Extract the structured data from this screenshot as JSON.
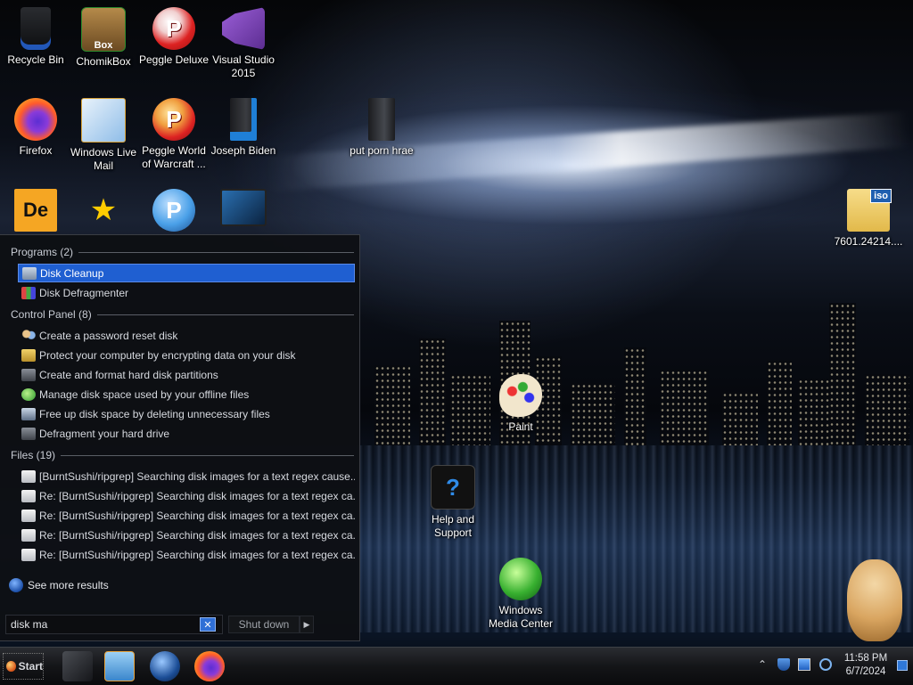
{
  "desktop_icons": [
    {
      "label": "Recycle Bin",
      "icon": "recycle-bin-icon"
    },
    {
      "label": "ChomikBox",
      "icon": "chomikbox-icon"
    },
    {
      "label": "Peggle Deluxe",
      "icon": "peggle-icon"
    },
    {
      "label": "Visual Studio 2015",
      "icon": "visual-studio-icon"
    },
    {
      "label": "Firefox",
      "icon": "firefox-icon"
    },
    {
      "label": "Windows Live Mail",
      "icon": "mail-icon"
    },
    {
      "label": "Peggle World of Warcraft ...",
      "icon": "peggle-icon"
    },
    {
      "label": "Joseph Biden",
      "icon": "user-folder-icon"
    },
    {
      "label": "put porn hrae",
      "icon": "folder-icon"
    },
    {
      "label": "7601.24214....",
      "icon": "iso-icon"
    },
    {
      "label": "Paint",
      "icon": "paint-icon"
    },
    {
      "label": "Help and Support",
      "icon": "help-icon"
    },
    {
      "label": "Windows Media Center",
      "icon": "media-center-icon"
    }
  ],
  "start_menu": {
    "sections": {
      "programs": "Programs (2)",
      "control_panel": "Control Panel (8)",
      "files": "Files (19)"
    },
    "programs": [
      "Disk Cleanup",
      "Disk Defragmenter"
    ],
    "control_panel": [
      "Create a password reset disk",
      "Protect your computer by encrypting data on your disk",
      "Create and format hard disk partitions",
      "Manage disk space used by your offline files",
      "Free up disk space by deleting unnecessary files",
      "Defragment your hard drive"
    ],
    "files": [
      "[BurntSushi/ripgrep] Searching disk images for a text regex cause...",
      "Re: [BurntSushi/ripgrep] Searching disk images for a text regex ca...",
      "Re: [BurntSushi/ripgrep] Searching disk images for a text regex ca...",
      "Re: [BurntSushi/ripgrep] Searching disk images for a text regex ca...",
      "Re: [BurntSushi/ripgrep] Searching disk images for a text regex ca..."
    ],
    "see_more": "See more results",
    "search_value": "disk ma",
    "shutdown_label": "Shut down",
    "shutdown_arrow": "▶",
    "clear_glyph": "✕"
  },
  "taskbar": {
    "start_label": "Start",
    "pinned": [
      "explorer-icon",
      "media-player-icon",
      "network-globe-icon",
      "firefox-icon"
    ],
    "tray_expand": "⌃",
    "time": "11:58 PM",
    "date": "6/7/2024"
  },
  "colors": {
    "selection": "#1f5fd1",
    "accent": "#2f78d8"
  }
}
